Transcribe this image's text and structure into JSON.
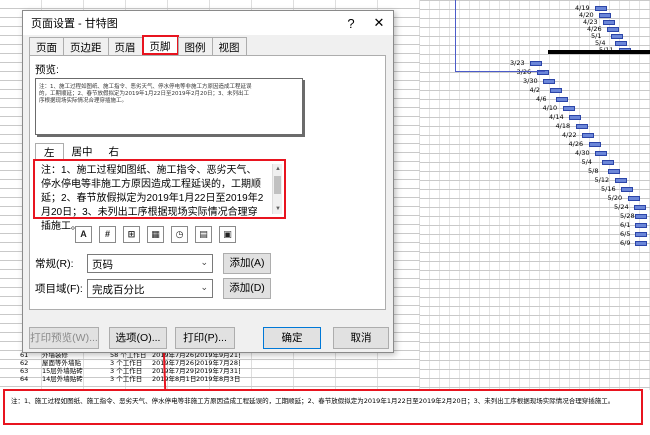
{
  "dialog": {
    "title": "页面设置 - 甘特图",
    "help_glyph": "?",
    "close_glyph": "✕",
    "tabs": [
      "页面",
      "页边距",
      "页眉",
      "页脚",
      "图例",
      "视图"
    ],
    "active_tab": "页脚",
    "preview_label": "预览:",
    "preview_text": "注：1、施工过程如图纸、施工指令、恶劣天气、停水停电等非施工方原因造成工程延误的，工期顺延；2、春节放假拟定为2019年1月22日至2019年2月20日；3、未列出工序根据现场实际情况合理穿插施工。",
    "align_tabs": [
      "左",
      "居中",
      "右"
    ],
    "footer_text": "注：1、施工过程如图纸、施工指令、恶劣天气、停水停电等非施工方原因造成工程延误的，工期顺延；2、春节放假拟定为2019年1月22日至2019年2月20日；3、未列出工序根据现场实际情况合理穿插施工。",
    "insert_icons": [
      "A",
      "#",
      "⊞",
      "▦",
      "◷",
      "▤",
      "▣"
    ],
    "general_label": "常规(R):",
    "general_value": "页码",
    "project_field_label": "项目域(F):",
    "project_field_value": "完成百分比",
    "add_a_label": "添加(A)",
    "add_d_label": "添加(D)",
    "print_preview_label": "打印预览(W)...",
    "options_label": "选项(O)...",
    "print_label": "打印(P)...",
    "ok_label": "确定",
    "cancel_label": "取消"
  },
  "table_rows": [
    [
      "61",
      "外墙装修",
      "58 个工作日",
      "2019年7月26日",
      "2019年9月21日"
    ],
    [
      "62",
      "屋面等外墙贴",
      "3 个工作日",
      "2019年7月26日",
      "2019年7月28日"
    ],
    [
      "63",
      "15层外墙贴砖",
      "3 个工作日",
      "2019年7月29日",
      "2019年7月31日"
    ],
    [
      "64",
      "14层外墙贴砖",
      "3 个工作日",
      "2019年8月1日",
      "2019年8月3日"
    ]
  ],
  "gantt_labels": [
    "4/19",
    "4/20",
    "4/23",
    "4/26",
    "5/1",
    "5/4",
    "5/11",
    "3/23",
    "3/26",
    "3/30",
    "4/2",
    "4/6",
    "4/10",
    "4/14",
    "4/18",
    "4/22",
    "4/26",
    "4/30",
    "5/4",
    "5/8",
    "5/12",
    "5/16",
    "5/20",
    "5/24",
    "5/28",
    "6/1",
    "6/5",
    "6/9"
  ],
  "footer_annotation": "注：1、施工过程如图纸、施工指令、恶劣天气、停水停电等非施工方原因造成工程延误的，工期顺延；2、春节放假拟定为2019年1月22日至2019年2月20日；3、未列出工序根据现场实际情况合理穿插施工。",
  "colors": {
    "highlight_red": "#e8141f",
    "gantt_bar": "#6b86d8",
    "dialog_bg": "#f0f0f0"
  }
}
